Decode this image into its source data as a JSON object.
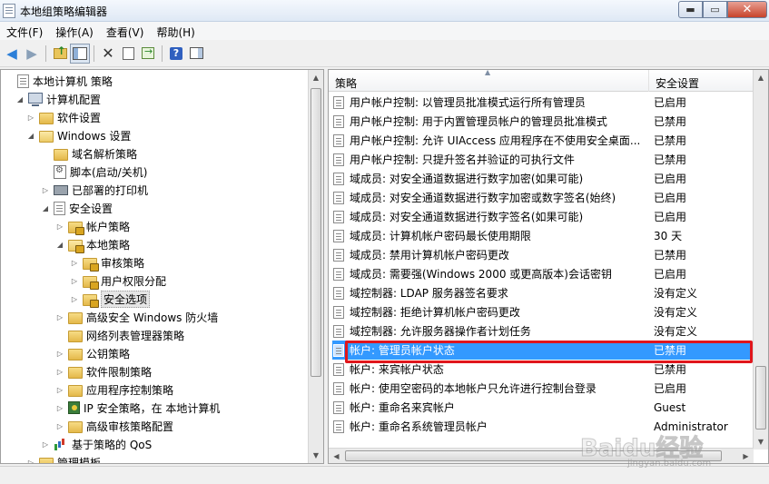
{
  "window": {
    "title": "本地组策略编辑器",
    "min_label": "▬",
    "max_label": "▭",
    "close_label": "✕"
  },
  "menu": [
    "文件(F)",
    "操作(A)",
    "查看(V)",
    "帮助(H)"
  ],
  "tree": [
    {
      "label": "本地计算机 策略",
      "icon": "policy-icon",
      "twisty": ""
    },
    {
      "label": "计算机配置",
      "icon": "computer-icon",
      "twisty": "◢"
    },
    {
      "label": "软件设置",
      "icon": "folder-icon",
      "twisty": "▷"
    },
    {
      "label": "Windows 设置",
      "icon": "folder-icon",
      "twisty": "◢"
    },
    {
      "label": "域名解析策略",
      "icon": "folder-icon",
      "twisty": ""
    },
    {
      "label": "脚本(启动/关机)",
      "icon": "script-icon",
      "twisty": ""
    },
    {
      "label": "已部署的打印机",
      "icon": "printer-icon",
      "twisty": "▷"
    },
    {
      "label": "安全设置",
      "icon": "security-settings-icon",
      "twisty": "◢"
    },
    {
      "label": "帐户策略",
      "icon": "lock-folder-icon",
      "twisty": "▷"
    },
    {
      "label": "本地策略",
      "icon": "lock-folder-icon",
      "twisty": "◢"
    },
    {
      "label": "审核策略",
      "icon": "lock-folder-icon",
      "twisty": "▷"
    },
    {
      "label": "用户权限分配",
      "icon": "lock-folder-icon",
      "twisty": "▷"
    },
    {
      "label": "安全选项",
      "icon": "lock-folder-icon",
      "twisty": "▷"
    },
    {
      "label": "高级安全 Windows 防火墙",
      "icon": "folder-icon",
      "twisty": "▷"
    },
    {
      "label": "网络列表管理器策略",
      "icon": "folder-icon",
      "twisty": ""
    },
    {
      "label": "公钥策略",
      "icon": "folder-icon",
      "twisty": "▷"
    },
    {
      "label": "软件限制策略",
      "icon": "folder-icon",
      "twisty": "▷"
    },
    {
      "label": "应用程序控制策略",
      "icon": "folder-icon",
      "twisty": "▷"
    },
    {
      "label": "IP 安全策略，在 本地计算机",
      "icon": "ipsec-icon",
      "twisty": "▷"
    },
    {
      "label": "高级审核策略配置",
      "icon": "folder-icon",
      "twisty": "▷"
    },
    {
      "label": "基于策略的 QoS",
      "icon": "qos-icon",
      "twisty": "▷"
    },
    {
      "label": "管理模板",
      "icon": "folder-icon",
      "twisty": "▷"
    }
  ],
  "list": {
    "col_policy": "策略",
    "col_setting": "安全设置",
    "rows": [
      {
        "name": "用户帐户控制: 以管理员批准模式运行所有管理员",
        "value": "已启用"
      },
      {
        "name": "用户帐户控制: 用于内置管理员帐户的管理员批准模式",
        "value": "已禁用"
      },
      {
        "name": "用户帐户控制: 允许 UIAccess 应用程序在不使用安全桌面...",
        "value": "已禁用"
      },
      {
        "name": "用户帐户控制: 只提升签名并验证的可执行文件",
        "value": "已禁用"
      },
      {
        "name": "域成员: 对安全通道数据进行数字加密(如果可能)",
        "value": "已启用"
      },
      {
        "name": "域成员: 对安全通道数据进行数字加密或数字签名(始终)",
        "value": "已启用"
      },
      {
        "name": "域成员: 对安全通道数据进行数字签名(如果可能)",
        "value": "已启用"
      },
      {
        "name": "域成员: 计算机帐户密码最长使用期限",
        "value": "30 天"
      },
      {
        "name": "域成员: 禁用计算机帐户密码更改",
        "value": "已禁用"
      },
      {
        "name": "域成员: 需要强(Windows 2000 或更高版本)会话密钥",
        "value": "已启用"
      },
      {
        "name": "域控制器: LDAP 服务器签名要求",
        "value": "没有定义"
      },
      {
        "name": "域控制器: 拒绝计算机帐户密码更改",
        "value": "没有定义"
      },
      {
        "name": "域控制器: 允许服务器操作者计划任务",
        "value": "没有定义"
      },
      {
        "name": "帐户: 管理员帐户状态",
        "value": "已禁用"
      },
      {
        "name": "帐户: 来宾帐户状态",
        "value": "已禁用"
      },
      {
        "name": "帐户: 使用空密码的本地帐户只允许进行控制台登录",
        "value": "已启用"
      },
      {
        "name": "帐户: 重命名来宾帐户",
        "value": "Guest"
      },
      {
        "name": "帐户: 重命名系统管理员帐户",
        "value": "Administrator"
      }
    ],
    "highlight_index": 13
  },
  "watermark": {
    "text": "Baidu经验",
    "sub": "jingyan.baidu.com"
  }
}
